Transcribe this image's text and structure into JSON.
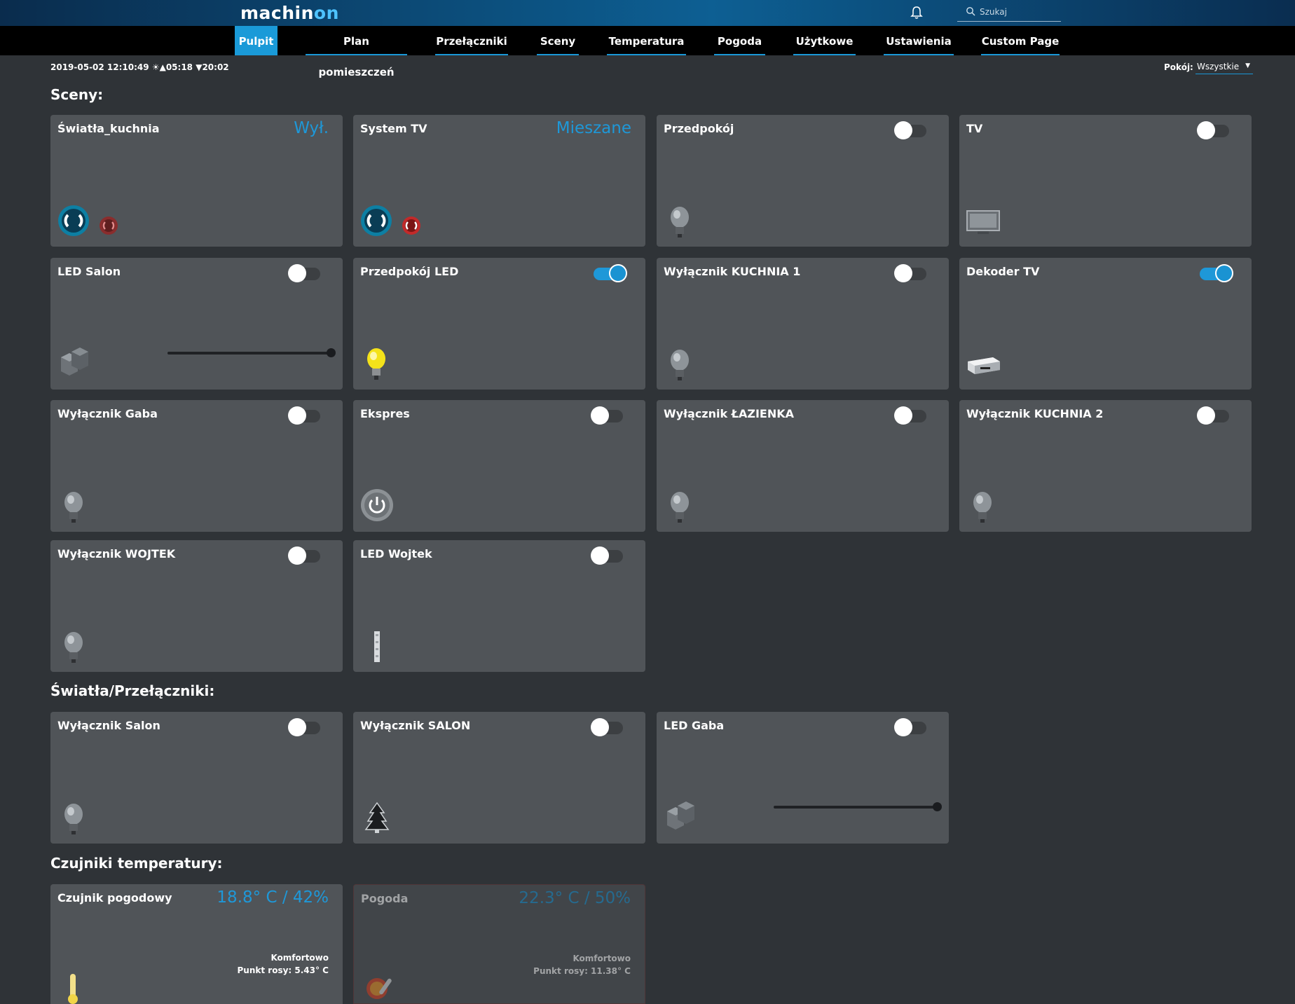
{
  "header": {
    "logo_main": "machin",
    "logo_on": "on",
    "search_placeholder": "Szukaj"
  },
  "nav": {
    "items": [
      "Pulpit",
      "Plan pomieszczeń",
      "Przełączniki",
      "Sceny",
      "Temperatura",
      "Pogoda",
      "Użytkowe",
      "Ustawienia",
      "Custom Page"
    ],
    "active": "Pulpit"
  },
  "infobar": {
    "datetime": "2019-05-02 12:10:49",
    "sunrise_symbol": "☀▲",
    "sunrise": "05:18",
    "sunset_symbol": "▼",
    "sunset": "20:02",
    "room_label": "Pokój:",
    "room_value": "Wszystkie"
  },
  "sections": {
    "scenes": "Sceny:",
    "lights": "Światła/Przełączniki:",
    "temps": "Czujniki temperatury:"
  },
  "scenes": [
    {
      "title": "Światła_kuchnia",
      "status": "Wył.",
      "icon": "scene-icon"
    },
    {
      "title": "System TV",
      "status": "Mieszane",
      "icon": "scene-icon"
    },
    {
      "title": "Przedpokój",
      "toggle": false,
      "icon": "bulb-off-icon"
    },
    {
      "title": "TV",
      "toggle": false,
      "icon": "tv-icon"
    },
    {
      "title": "LED Salon",
      "toggle": false,
      "icon": "dimmer-icon",
      "level": 1.0
    },
    {
      "title": "Przedpokój LED",
      "toggle": true,
      "icon": "bulb-on-icon"
    },
    {
      "title": "Wyłącznik KUCHNIA 1",
      "toggle": false,
      "icon": "bulb-off-icon"
    },
    {
      "title": "Dekoder TV",
      "toggle": true,
      "icon": "decoder-icon"
    },
    {
      "title": "Wyłącznik Gaba",
      "toggle": false,
      "icon": "bulb-off-icon"
    },
    {
      "title": "Ekspres",
      "toggle": false,
      "icon": "power-icon"
    },
    {
      "title": "Wyłącznik ŁAZIENKA",
      "toggle": false,
      "icon": "bulb-off-icon"
    },
    {
      "title": "Wyłącznik KUCHNIA 2",
      "toggle": false,
      "icon": "bulb-off-icon"
    },
    {
      "title": "Wyłącznik WOJTEK",
      "toggle": false,
      "icon": "bulb-off-icon"
    },
    {
      "title": "LED Wojtek",
      "toggle": false,
      "icon": "led-strip-icon"
    }
  ],
  "lights": [
    {
      "title": "Wyłącznik Salon",
      "toggle": false,
      "icon": "bulb-off-icon"
    },
    {
      "title": "Wyłącznik SALON",
      "toggle": false,
      "icon": "xmas-tree-icon"
    },
    {
      "title": "LED Gaba",
      "toggle": false,
      "icon": "dimmer-icon",
      "level": 1.0
    }
  ],
  "temps": [
    {
      "title": "Czujnik pogodowy",
      "value": "18.8° C / 42%",
      "comfort": "Komfortowo",
      "dew": "Punkt rosy: 5.43° C",
      "icon": "thermometer-icon"
    },
    {
      "title": "Pogoda",
      "value": "22.3° C / 50%",
      "comfort": "Komfortowo",
      "dew": "Punkt rosy: 11.38° C",
      "icon": "weather-icon"
    }
  ],
  "colors": {
    "accent": "#1e98d8",
    "card": "#505458",
    "background": "#2f3337"
  }
}
